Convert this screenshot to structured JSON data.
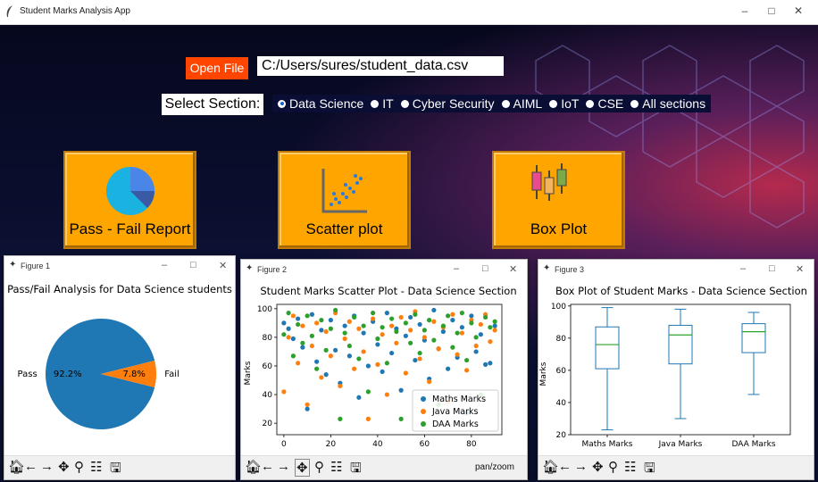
{
  "window": {
    "title": "Student Marks Analysis App"
  },
  "controls": {
    "open_file_label": "Open File",
    "file_path": "C:/Users/sures/student_data.csv",
    "select_section_label": "Select Section:",
    "sections": [
      "Data Science",
      "IT",
      "Cyber Security",
      "AIML",
      "IoT",
      "CSE",
      "All sections"
    ],
    "selected_section": "Data Science"
  },
  "buttons": {
    "pass_fail": "Pass - Fail Report",
    "scatter": "Scatter plot",
    "box": "Box Plot"
  },
  "figures": {
    "fig1": {
      "window_title": "Figure 1"
    },
    "fig2": {
      "window_title": "Figure 2",
      "status": "pan/zoom"
    },
    "fig3": {
      "window_title": "Figure 3"
    }
  },
  "colors": {
    "accent_orange": "#ffa500",
    "open_file": "#ff4500",
    "maths": "#1f77b4",
    "java": "#ff7f0e",
    "daa": "#2ca02c"
  },
  "chart_data": [
    {
      "type": "pie",
      "title": "Pass/Fail Analysis for Data Science students",
      "labels": [
        "Pass",
        "Fail"
      ],
      "values": [
        92.2,
        7.8
      ],
      "value_labels": [
        "92.2%",
        "7.8%"
      ]
    },
    {
      "type": "scatter",
      "title": "Student Marks Scatter Plot - Data Science Section",
      "xlabel": "",
      "ylabel": "Marks",
      "xlim": [
        -3,
        93
      ],
      "ylim": [
        12,
        103
      ],
      "xticks": [
        0,
        20,
        40,
        60,
        80
      ],
      "yticks": [
        20,
        40,
        60,
        80,
        100
      ],
      "legend": "lower-right",
      "series": [
        {
          "name": "Maths Marks",
          "points": [
            [
              0,
              90
            ],
            [
              2,
              86
            ],
            [
              4,
              79
            ],
            [
              6,
              93
            ],
            [
              8,
              73
            ],
            [
              10,
              30
            ],
            [
              12,
              96
            ],
            [
              14,
              63
            ],
            [
              16,
              85
            ],
            [
              18,
              54
            ],
            [
              20,
              92
            ],
            [
              22,
              71
            ],
            [
              24,
              48
            ],
            [
              26,
              88
            ],
            [
              28,
              67
            ],
            [
              30,
              95
            ],
            [
              32,
              38
            ],
            [
              34,
              83
            ],
            [
              36,
              60
            ],
            [
              38,
              91
            ],
            [
              40,
              75
            ],
            [
              42,
              56
            ],
            [
              44,
              97
            ],
            [
              46,
              69
            ],
            [
              48,
              86
            ],
            [
              50,
              43
            ],
            [
              52,
              81
            ],
            [
              54,
              94
            ],
            [
              56,
              64
            ],
            [
              58,
              89
            ],
            [
              60,
              78
            ],
            [
              62,
              51
            ],
            [
              64,
              99
            ],
            [
              66,
              72
            ],
            [
              68,
              84
            ],
            [
              70,
              58
            ],
            [
              72,
              92
            ],
            [
              74,
              66
            ],
            [
              76,
              87
            ],
            [
              78,
              27
            ],
            [
              80,
              95
            ],
            [
              82,
              70
            ],
            [
              84,
              82
            ],
            [
              86,
              61
            ],
            [
              88,
              62
            ],
            [
              90,
              88
            ]
          ]
        },
        {
          "name": "Java Marks",
          "points": [
            [
              0,
              42
            ],
            [
              2,
              80
            ],
            [
              4,
              95
            ],
            [
              6,
              62
            ],
            [
              8,
              88
            ],
            [
              10,
              33
            ],
            [
              12,
              74
            ],
            [
              14,
              90
            ],
            [
              16,
              52
            ],
            [
              18,
              84
            ],
            [
              20,
              67
            ],
            [
              22,
              97
            ],
            [
              24,
              46
            ],
            [
              26,
              79
            ],
            [
              28,
              91
            ],
            [
              30,
              58
            ],
            [
              32,
              86
            ],
            [
              34,
              70
            ],
            [
              36,
              23
            ],
            [
              38,
              93
            ],
            [
              40,
              61
            ],
            [
              42,
              82
            ],
            [
              44,
              40
            ],
            [
              46,
              88
            ],
            [
              48,
              76
            ],
            [
              50,
              94
            ],
            [
              52,
              55
            ],
            [
              54,
              85
            ],
            [
              56,
              98
            ],
            [
              58,
              65
            ],
            [
              60,
              80
            ],
            [
              62,
              49
            ],
            [
              64,
              91
            ],
            [
              66,
              72
            ],
            [
              68,
              87
            ],
            [
              70,
              35
            ],
            [
              72,
              96
            ],
            [
              74,
              68
            ],
            [
              76,
              83
            ],
            [
              78,
              57
            ],
            [
              80,
              92
            ],
            [
              82,
              74
            ],
            [
              84,
              89
            ],
            [
              86,
              96
            ],
            [
              88,
              77
            ],
            [
              90,
              85
            ]
          ]
        },
        {
          "name": "DAA Marks",
          "points": [
            [
              0,
              82
            ],
            [
              2,
              97
            ],
            [
              4,
              67
            ],
            [
              6,
              89
            ],
            [
              8,
              76
            ],
            [
              10,
              95
            ],
            [
              12,
              81
            ],
            [
              14,
              58
            ],
            [
              16,
              92
            ],
            [
              18,
              71
            ],
            [
              20,
              86
            ],
            [
              22,
              99
            ],
            [
              24,
              23
            ],
            [
              26,
              83
            ],
            [
              28,
              74
            ],
            [
              30,
              94
            ],
            [
              32,
              65
            ],
            [
              34,
              88
            ],
            [
              36,
              42
            ],
            [
              38,
              97
            ],
            [
              40,
              79
            ],
            [
              42,
              87
            ],
            [
              44,
              62
            ],
            [
              46,
              93
            ],
            [
              48,
              84
            ],
            [
              50,
              23
            ],
            [
              52,
              90
            ],
            [
              54,
              76
            ],
            [
              56,
              96
            ],
            [
              58,
              69
            ],
            [
              60,
              85
            ],
            [
              62,
              92
            ],
            [
              64,
              78
            ],
            [
              66,
              33
            ],
            [
              68,
              88
            ],
            [
              70,
              95
            ],
            [
              72,
              73
            ],
            [
              74,
              83
            ],
            [
              76,
              97
            ],
            [
              78,
              64
            ],
            [
              80,
              90
            ],
            [
              82,
              80
            ],
            [
              84,
              40
            ],
            [
              86,
              94
            ],
            [
              88,
              87
            ],
            [
              90,
              91
            ]
          ]
        }
      ]
    },
    {
      "type": "box",
      "title": "Box Plot of Student Marks - Data Science Section",
      "ylabel": "Marks",
      "ylim": [
        20,
        101
      ],
      "yticks": [
        20,
        40,
        60,
        80,
        100
      ],
      "categories": [
        "Maths Marks",
        "Java Marks",
        "DAA Marks"
      ],
      "boxes": [
        {
          "min": 23,
          "q1": 61,
          "median": 76,
          "q3": 87,
          "max": 99
        },
        {
          "min": 30,
          "q1": 64,
          "median": 82,
          "q3": 88,
          "max": 98
        },
        {
          "min": 45,
          "q1": 71,
          "median": 84,
          "q3": 89,
          "max": 96
        }
      ]
    }
  ]
}
